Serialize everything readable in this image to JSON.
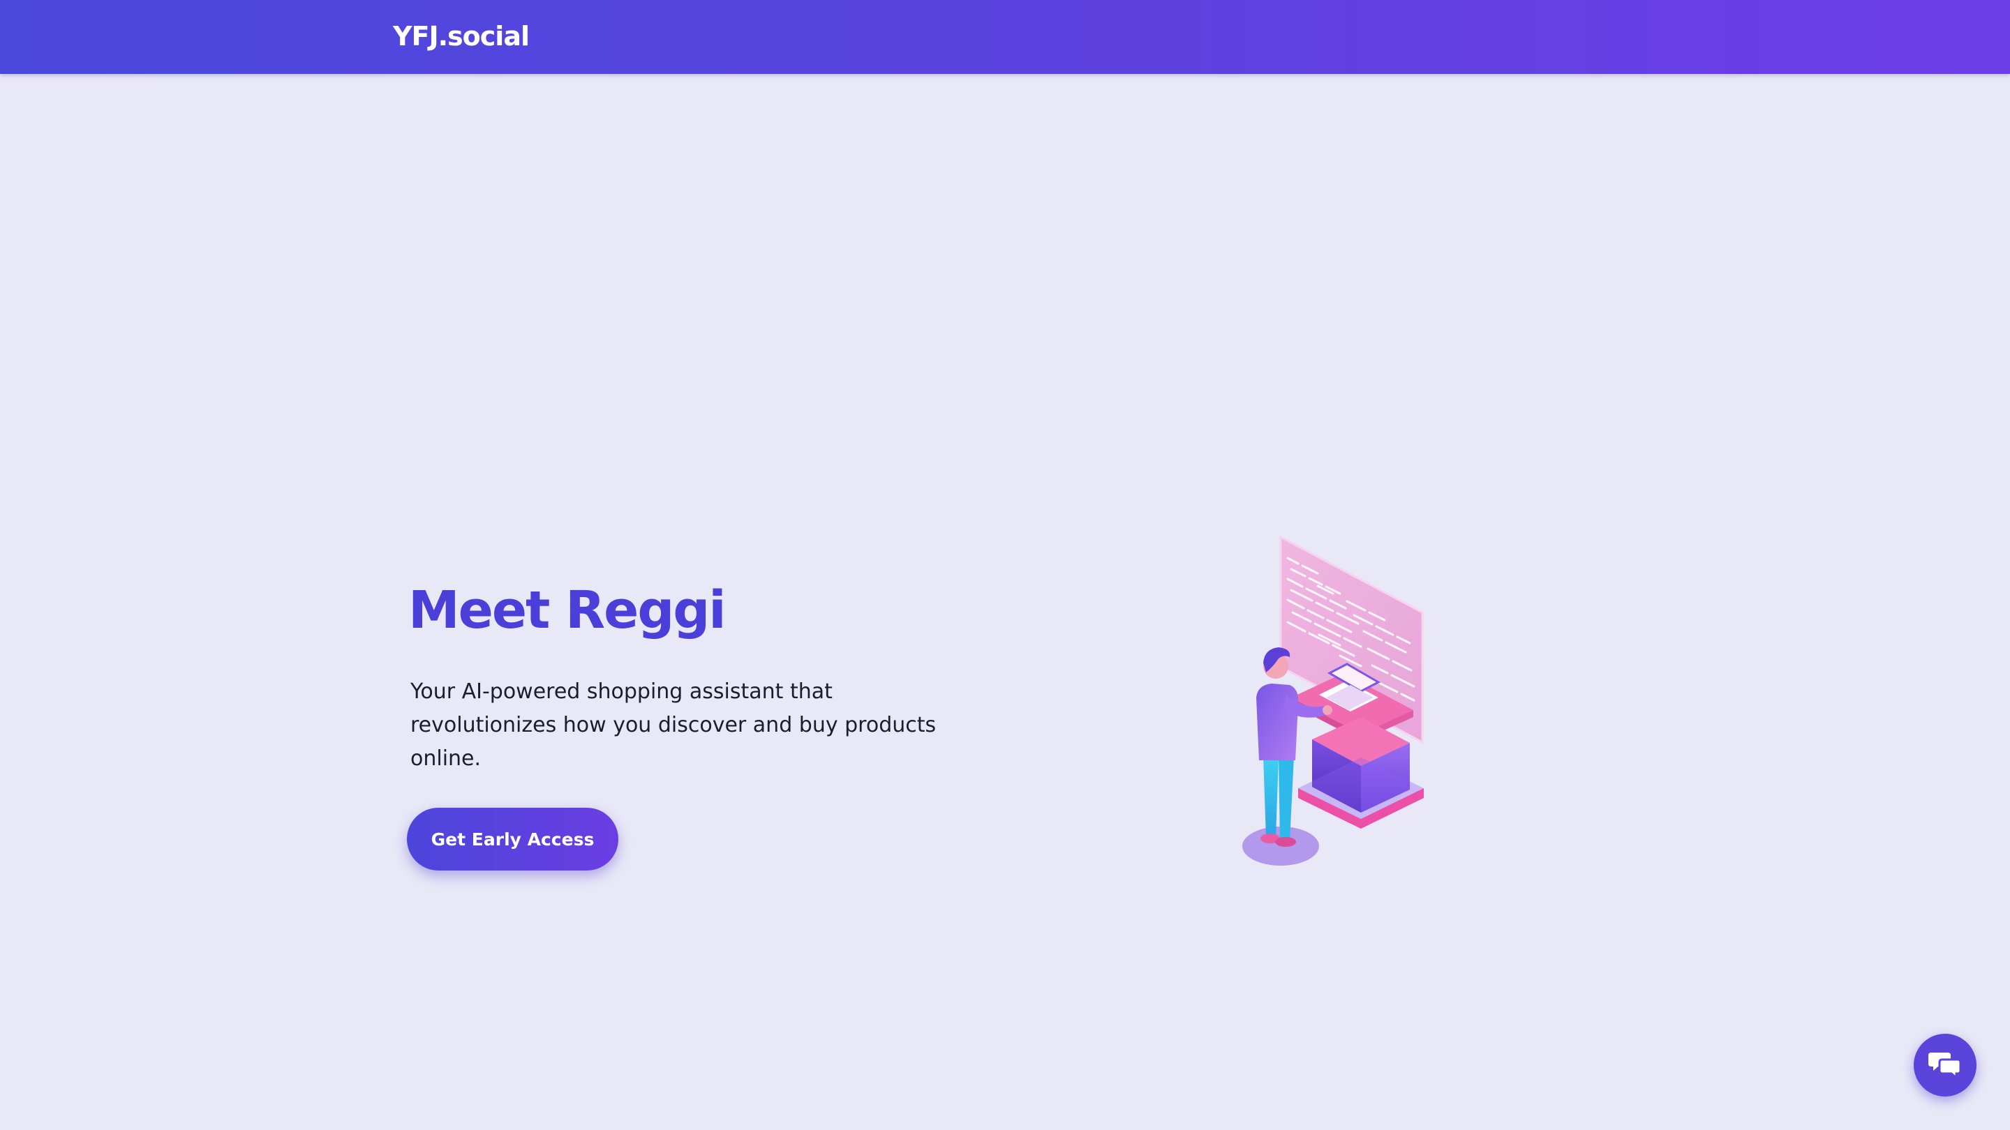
{
  "nav": {
    "brand": "YFJ.social"
  },
  "hero": {
    "title": "Meet Reggi",
    "subtitle": "Your AI-powered shopping assistant that revolutionizes how you discover and buy products online.",
    "cta_label": "Get Early Access",
    "illustration_icon": "person-at-computer-illustration"
  },
  "chat": {
    "icon": "chat-bubbles-icon"
  },
  "colors": {
    "nav_gradient_start": "#4a48db",
    "nav_gradient_end": "#6d3de6",
    "accent": "#4a3fd8",
    "background": "#e8e8f7",
    "cta": "#5245dd"
  }
}
